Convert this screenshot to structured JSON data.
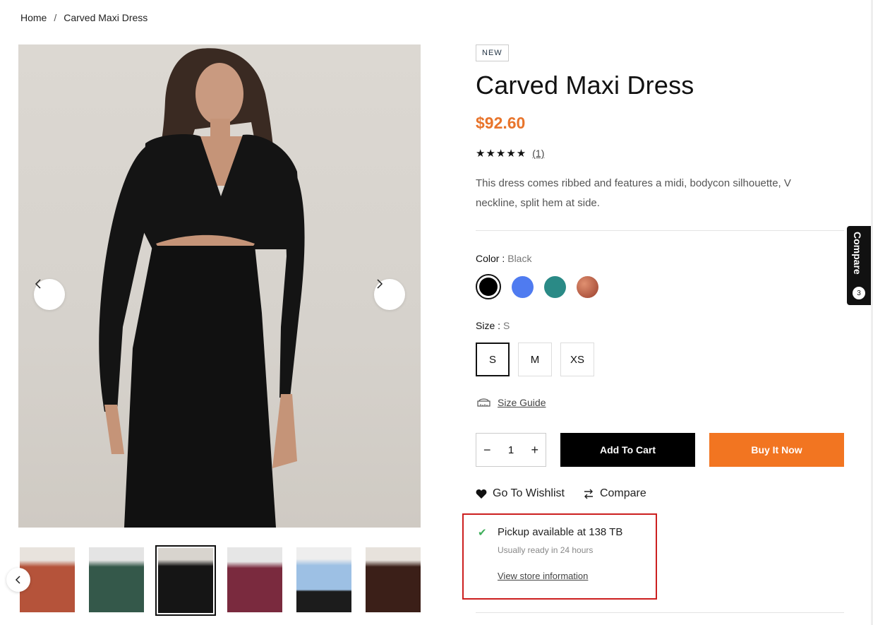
{
  "breadcrumb": {
    "home": "Home",
    "separator": "/",
    "current": "Carved Maxi Dress"
  },
  "product": {
    "badge": "NEW",
    "title": "Carved Maxi Dress",
    "price": "$92.60",
    "stars": "★★★★★",
    "review_count": "(1)",
    "description": "This dress comes ribbed and features a midi, bodycon silhouette, V neckline, split hem at side."
  },
  "options": {
    "color_label": "Color :",
    "color_value": "Black",
    "colors": [
      "#000000",
      "#4f7bf0",
      "#2a8a86",
      "#b1503a"
    ],
    "size_label": "Size :",
    "size_value": "S",
    "sizes": [
      "S",
      "M",
      "XS"
    ],
    "size_guide": "Size Guide"
  },
  "cart": {
    "quantity": "1",
    "minus": "−",
    "plus": "+",
    "add_to_cart": "Add To Cart",
    "buy_now": "Buy It Now"
  },
  "actions": {
    "wishlist": "Go To Wishlist",
    "compare": "Compare"
  },
  "pickup": {
    "title": "Pickup available at 138 TB",
    "subtitle": "Usually ready in 24 hours",
    "link": "View store information"
  },
  "compare_tab": {
    "label": "Compare",
    "count": "3"
  },
  "thumbnails": [
    {
      "color": "#b5533a"
    },
    {
      "color": "#34584a"
    },
    {
      "color": "#151515"
    },
    {
      "color": "#7a2a3e"
    },
    {
      "color": "#9dc0e4"
    },
    {
      "color": "#3b1f18"
    }
  ],
  "colors": {
    "accent": "#f27521",
    "price": "#e8742b",
    "highlight_border": "#cc1f1f",
    "check": "#3fae5b"
  }
}
